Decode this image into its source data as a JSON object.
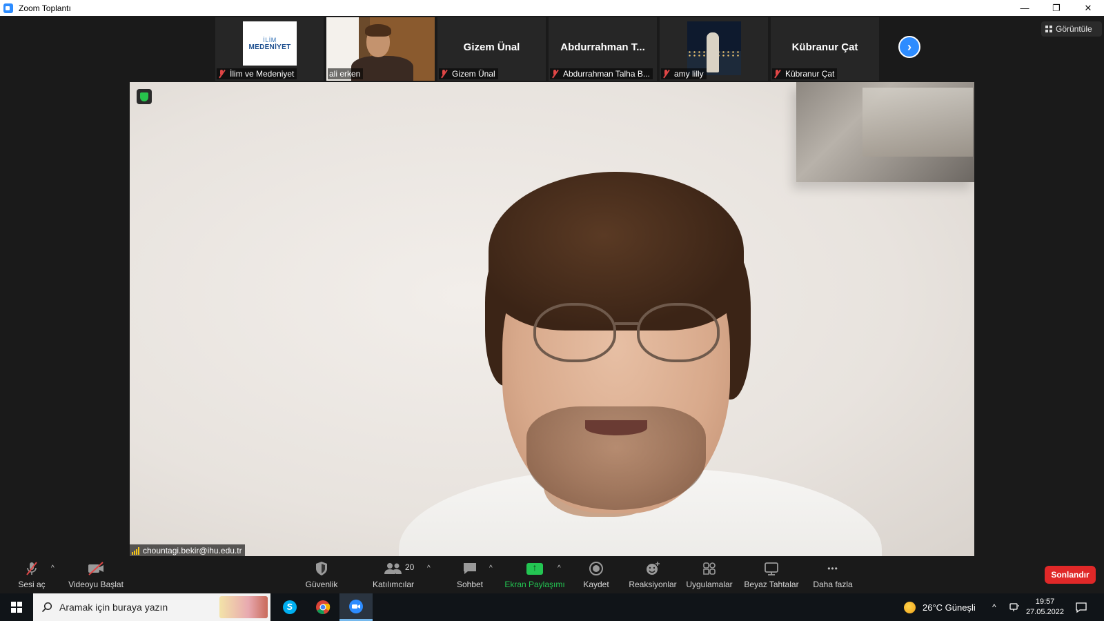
{
  "window": {
    "title": "Zoom Toplantı",
    "minimize_glyph": "—",
    "restore_glyph": "❐",
    "close_glyph": "✕"
  },
  "view_button": {
    "label": "Görüntüle",
    "icon": "grid-icon"
  },
  "participants_strip": [
    {
      "name": "İlim ve Medeniyet",
      "muted": true,
      "tile": "logo",
      "logo_line1": "İLİM",
      "logo_line2": "MEDENİYET"
    },
    {
      "name": "ali erken",
      "muted": false,
      "tile": "video"
    },
    {
      "name": "Gizem Ünal",
      "display_name": "Gizem Ünal",
      "muted": true,
      "tile": "name"
    },
    {
      "name": "Abdurrahman Talha B...",
      "display_name": "Abdurrahman T...",
      "muted": true,
      "tile": "name"
    },
    {
      "name": "amy lilly",
      "muted": true,
      "tile": "video"
    },
    {
      "name": "Kübranur Çat",
      "display_name": "Kübranur Çat",
      "muted": true,
      "tile": "name"
    }
  ],
  "next_page_glyph": "›",
  "main_speaker": {
    "name": "chountagi.bekir@ihu.edu.tr",
    "signal_bars": 4
  },
  "toolbar": {
    "unmute_label": "Sesi aç",
    "start_video_label": "Videoyu Başlat",
    "security_label": "Güvenlik",
    "participants_label": "Katılımcılar",
    "participants_count": "20",
    "chat_label": "Sohbet",
    "share_label": "Ekran Paylaşımı",
    "record_label": "Kaydet",
    "reactions_label": "Reaksiyonlar",
    "apps_label": "Uygulamalar",
    "whiteboard_label": "Beyaz Tahtalar",
    "more_label": "Daha fazla",
    "more_glyph": "•••",
    "caret_glyph": "^",
    "end_label": "Sonlandır",
    "share_color": "#23c552",
    "end_color": "#e02828"
  },
  "taskbar": {
    "search_placeholder": "Aramak için buraya yazın",
    "weather_text": "26°C  Güneşli",
    "time": "19:57",
    "date": "27.05.2022",
    "chevron_glyph": "^"
  }
}
